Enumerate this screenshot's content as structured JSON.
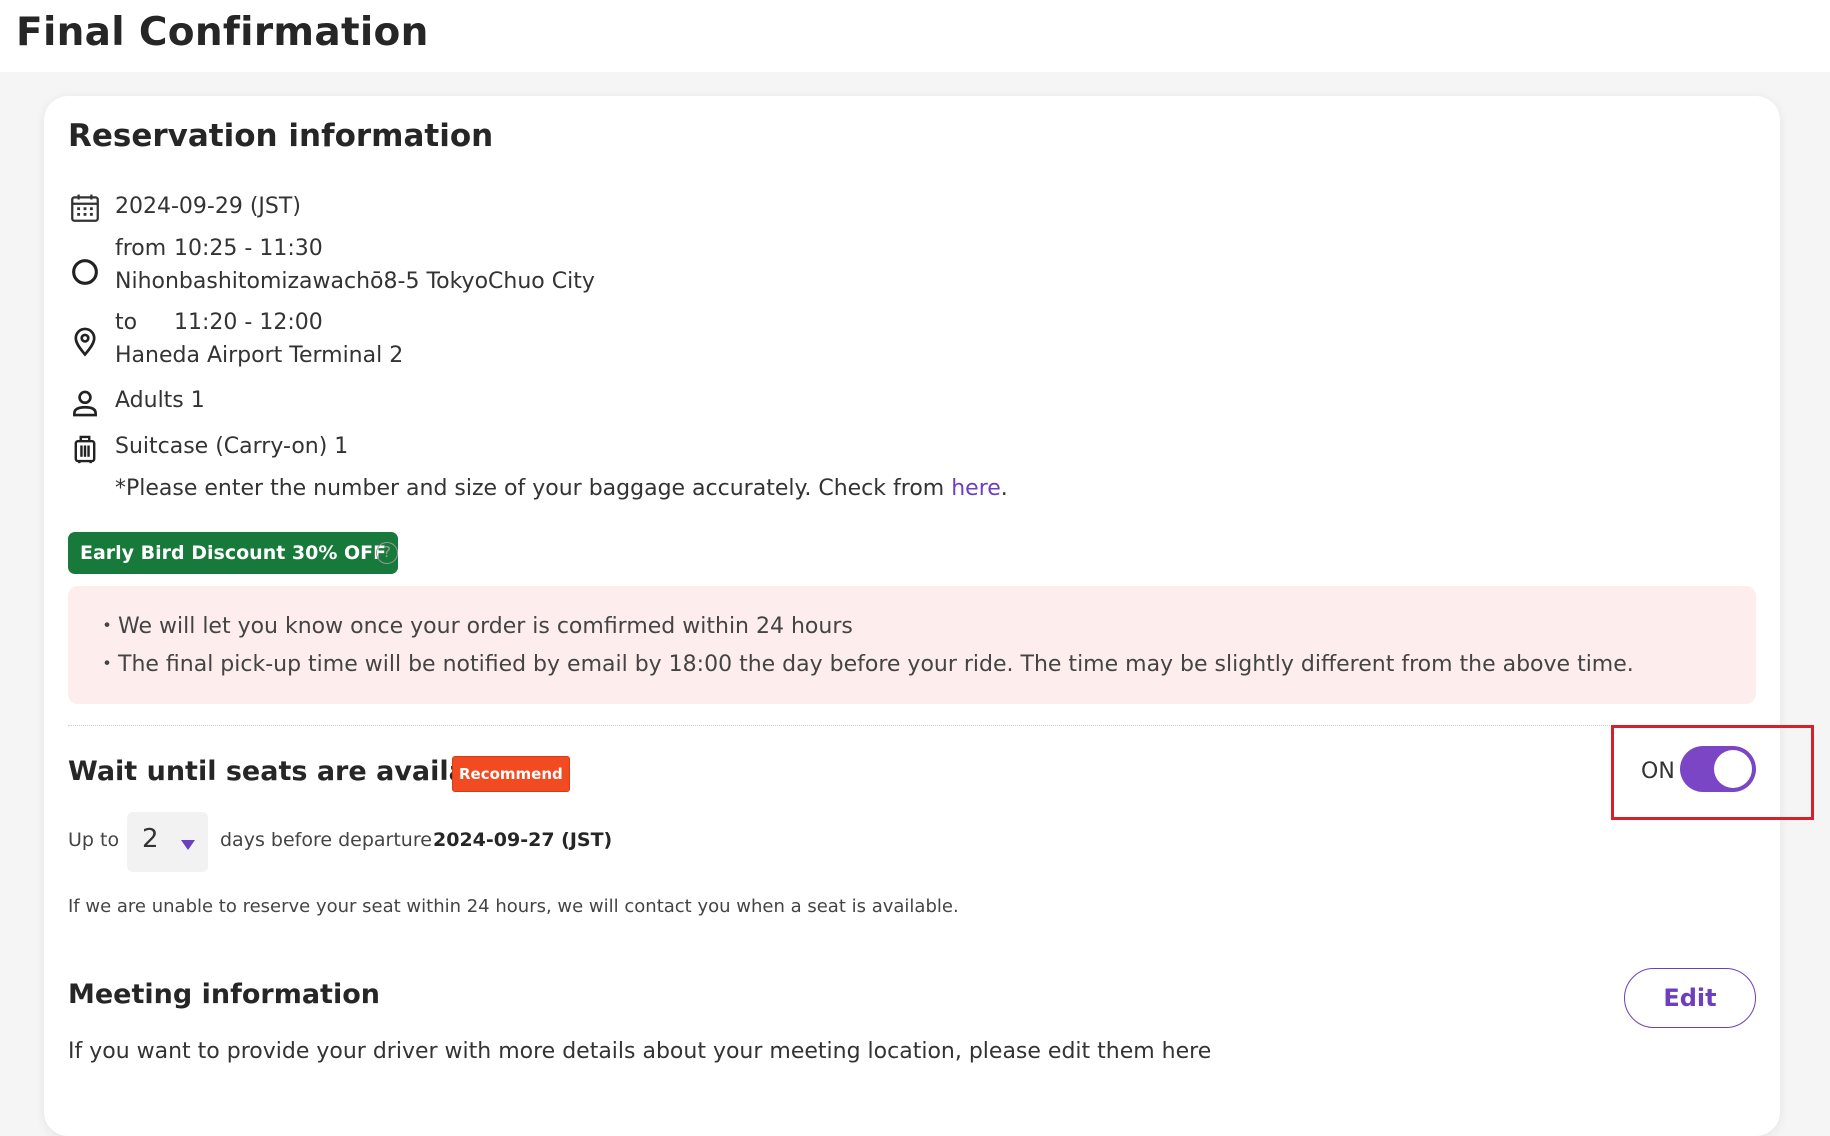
{
  "page": {
    "title": "Final Confirmation"
  },
  "reservation": {
    "title": "Reservation information",
    "date": "2024-09-29 (JST)",
    "from_label": "from",
    "from_time": "10:25 - 11:30",
    "from_address": "Nihonbashitomizawachō8-5 TokyoChuo City",
    "to_label": "to",
    "to_time": "11:20 - 12:00",
    "to_address": "Haneda Airport Terminal 2",
    "passengers": "Adults 1",
    "baggage": "Suitcase (Carry-on) 1",
    "baggage_note": "*Please enter the number and size of your baggage accurately. Check from ",
    "baggage_note_link": "here",
    "baggage_note_end": ".",
    "discount_badge": "Early Bird Discount 30% OFF",
    "help_icon": "?",
    "notices": [
      "・We will let you know once your order is comfirmed within 24 hours",
      "・The final pick-up time will be notified by email by 18:00 the day before your ride. The time may be slightly different from the above time."
    ]
  },
  "wait_seats": {
    "title": "Wait until seats are available",
    "recommend_badge": "Recommend",
    "toggle_label": "ON",
    "toggle_state": "on",
    "up_to_label": "Up to",
    "days_value": "2",
    "days_label": "days before departure",
    "deadline_date": "2024-09-27 (JST)",
    "note": "If we are unable to reserve your seat within 24 hours, we will contact you when a seat is available."
  },
  "meeting": {
    "title": "Meeting information",
    "edit_label": "Edit",
    "description": "If you want to provide your driver with more details about your meeting location, please edit them here"
  },
  "icons": {
    "calendar": "calendar-icon",
    "origin": "circle-origin-icon",
    "destination": "location-pin-icon",
    "person": "person-icon",
    "luggage": "luggage-icon"
  },
  "colors": {
    "accent": "#7a46c5",
    "link": "#6d3fc0",
    "discount": "#177a3a",
    "recommend": "#f24a21",
    "notice_bg": "#fdeeed",
    "highlight": "#d6212d"
  }
}
